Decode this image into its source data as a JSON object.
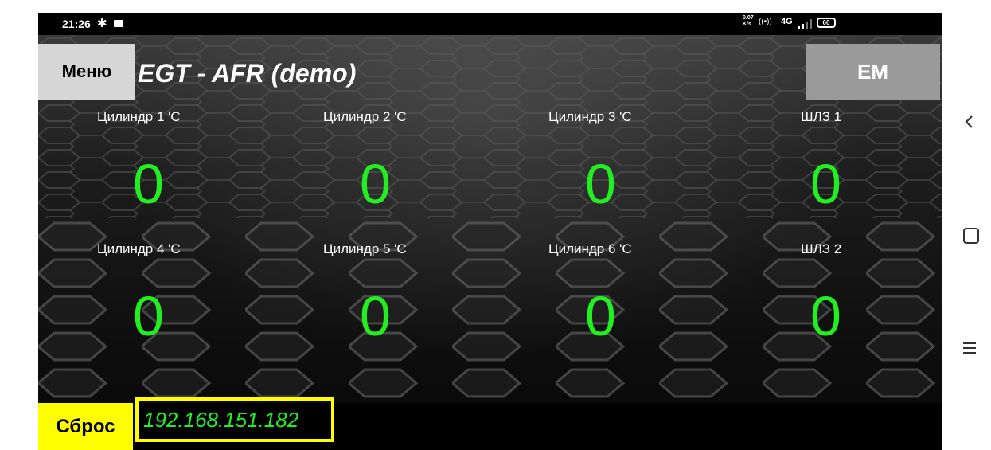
{
  "status_bar": {
    "time": "21:26",
    "bluetooth_icon": "bluetooth-icon",
    "speed_top": "0.07",
    "speed_bottom": "K/s",
    "network": "4G",
    "battery": "60"
  },
  "header": {
    "menu_label": "Меню",
    "title": "EGT - AFR (demo)",
    "em_label": "EM"
  },
  "sensors": [
    {
      "label": "Цилиндр 1 'C",
      "value": "0"
    },
    {
      "label": "Цилиндр 2 'C",
      "value": "0"
    },
    {
      "label": "Цилиндр 3 'C",
      "value": "0"
    },
    {
      "label": "ШЛЗ 1",
      "value": "0"
    },
    {
      "label": "Цилиндр 4 'C",
      "value": "0"
    },
    {
      "label": "Цилиндр 5 'C",
      "value": "0"
    },
    {
      "label": "Цилиндр 6 'C",
      "value": "0"
    },
    {
      "label": "ШЛЗ 2",
      "value": "0"
    }
  ],
  "footer": {
    "reset_label": "Сброс",
    "ip_address": "192.168.151.182"
  },
  "colors": {
    "value_green": "#22ee22",
    "highlight_yellow": "#ffff00",
    "menu_button_bg": "#d6d6d6",
    "em_button_bg": "#9a9a9a"
  },
  "nav_icons": [
    "back-icon",
    "home-icon",
    "recent-apps-icon"
  ]
}
